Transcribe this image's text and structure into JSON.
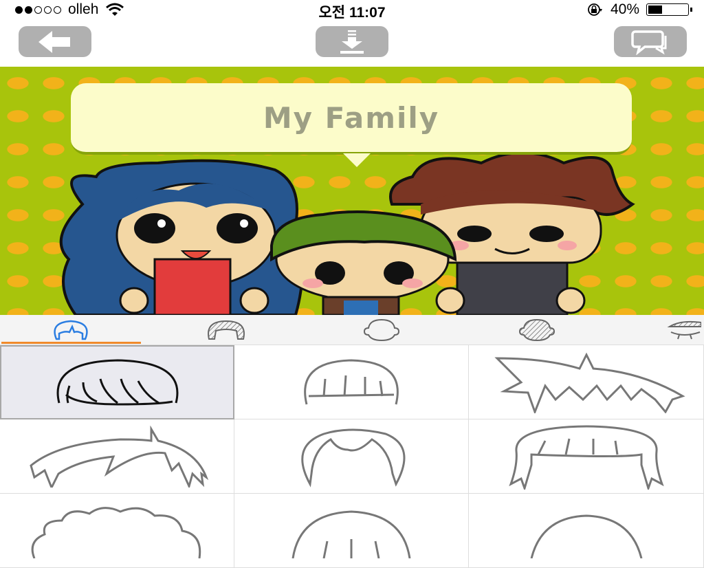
{
  "status_bar": {
    "signal_dots_filled": 2,
    "signal_dots_total": 5,
    "carrier": "olleh",
    "time": "오전 11:07",
    "battery_percent_label": "40%",
    "battery_level": 0.4,
    "icons": [
      "wifi-icon",
      "rotation-lock-icon",
      "battery-icon"
    ]
  },
  "toolbar": {
    "back_icon": "arrow-left-icon",
    "download_icon": "download-icon",
    "share_icon": "chat-bubbles-icon",
    "button_color": "#b0b0b0"
  },
  "canvas": {
    "speech_bubble_text": "My Family",
    "background_color": "#a8c40c",
    "dot_color": "#f2b21a",
    "characters": [
      "mother",
      "child",
      "father"
    ]
  },
  "category_tabs": {
    "active_index": 0,
    "accent_color": "#f08a2c",
    "active_icon_color": "#2a7de1",
    "items": [
      {
        "icon": "front-hair-icon",
        "active": true
      },
      {
        "icon": "back-hair-icon",
        "active": false
      },
      {
        "icon": "face-shape-icon",
        "active": false
      },
      {
        "icon": "hair-color-icon",
        "active": false
      },
      {
        "icon": "eyes-icon",
        "active": false
      }
    ]
  },
  "hair_options": {
    "selected_index": 0,
    "items": [
      {
        "style": "bowl-cut"
      },
      {
        "style": "straight-bangs"
      },
      {
        "style": "spiky"
      },
      {
        "style": "side-swept"
      },
      {
        "style": "center-part"
      },
      {
        "style": "long-bangs"
      },
      {
        "style": "curly"
      },
      {
        "style": "round-bangs"
      },
      {
        "style": "rounded"
      }
    ]
  }
}
